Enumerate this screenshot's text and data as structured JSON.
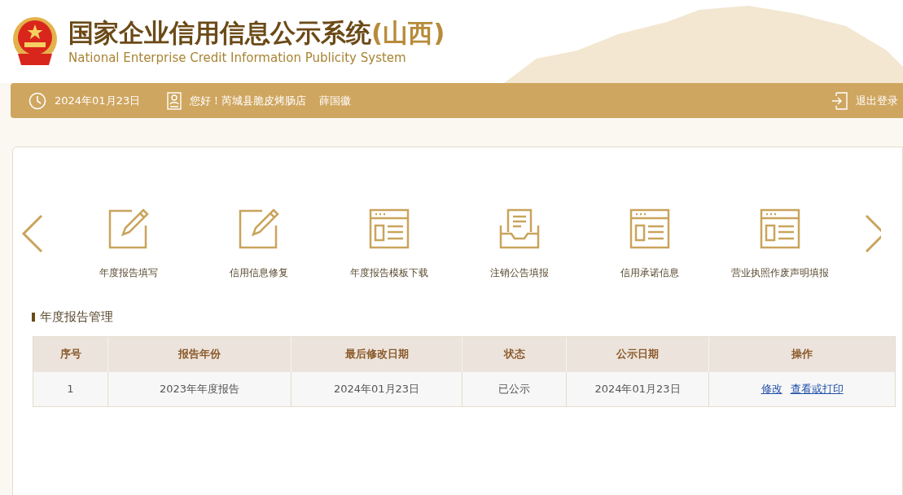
{
  "header": {
    "title": "国家企业信用信息公示系统",
    "region": "(山西)",
    "subtitle": "National Enterprise Credit Information Publicity System"
  },
  "topbar": {
    "date": "2024年01月23日",
    "greeting": "您好！芮城县脆皮烤肠店",
    "user": "薛国徽",
    "logout": "退出登录"
  },
  "shortcuts": [
    {
      "kind": "edit",
      "label": "年度报告填写"
    },
    {
      "kind": "edit",
      "label": "信用信息修复"
    },
    {
      "kind": "template",
      "label": "年度报告模板下载"
    },
    {
      "kind": "inbox",
      "label": "注销公告填报"
    },
    {
      "kind": "template",
      "label": "信用承诺信息"
    },
    {
      "kind": "template",
      "label": "营业执照作废声明填报"
    }
  ],
  "section_title": "年度报告管理",
  "table": {
    "columns": [
      "序号",
      "报告年份",
      "最后修改日期",
      "状态",
      "公示日期",
      "操作"
    ],
    "rows": [
      {
        "cells": [
          "1",
          "2023年年度报告",
          "2024年01月23日",
          "已公示",
          "2024年01月23日"
        ],
        "actions": [
          "修改",
          "查看或打印"
        ]
      }
    ]
  }
}
